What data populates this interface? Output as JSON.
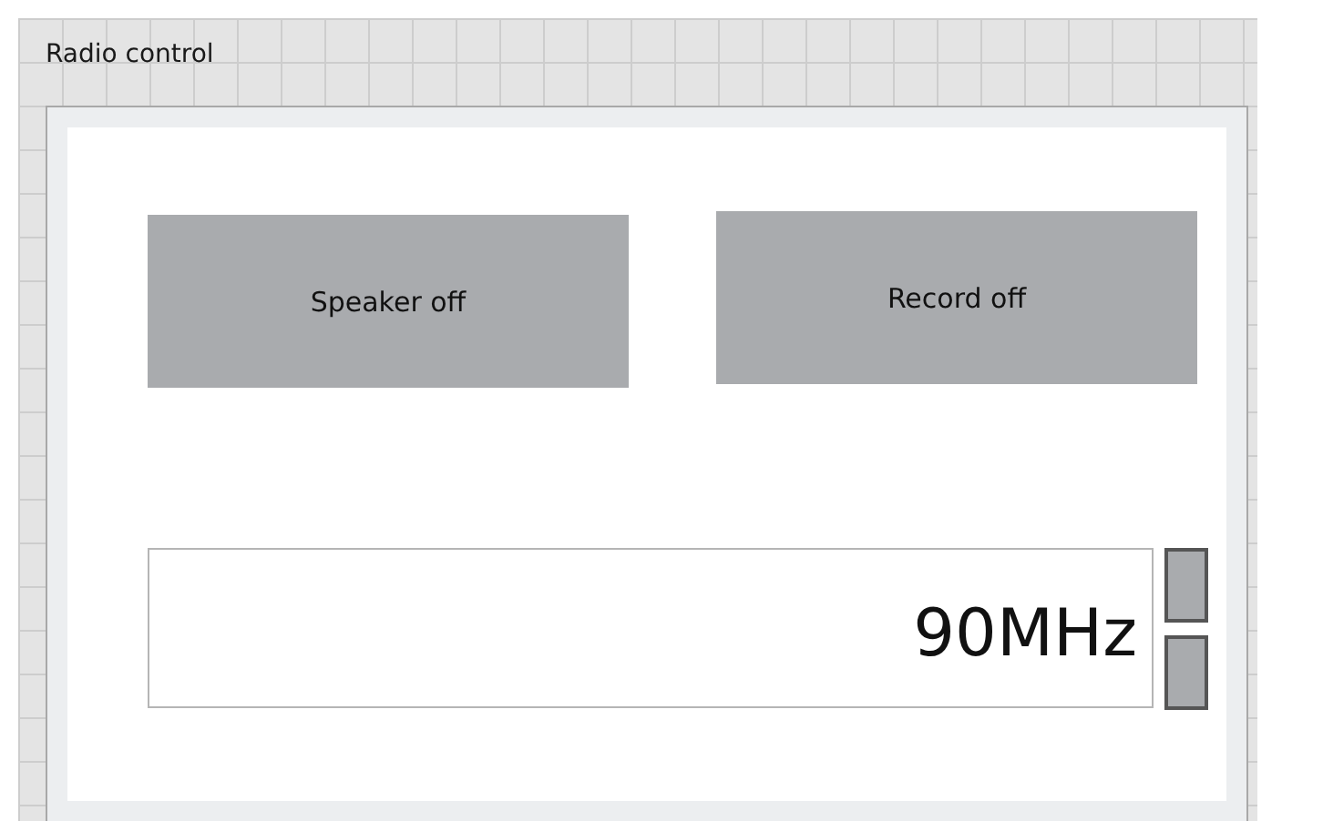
{
  "window": {
    "title": "Radio control"
  },
  "buttons": [
    {
      "label": "Speaker off"
    },
    {
      "label": "Record off"
    }
  ],
  "frequency": {
    "value": "90MHz"
  }
}
